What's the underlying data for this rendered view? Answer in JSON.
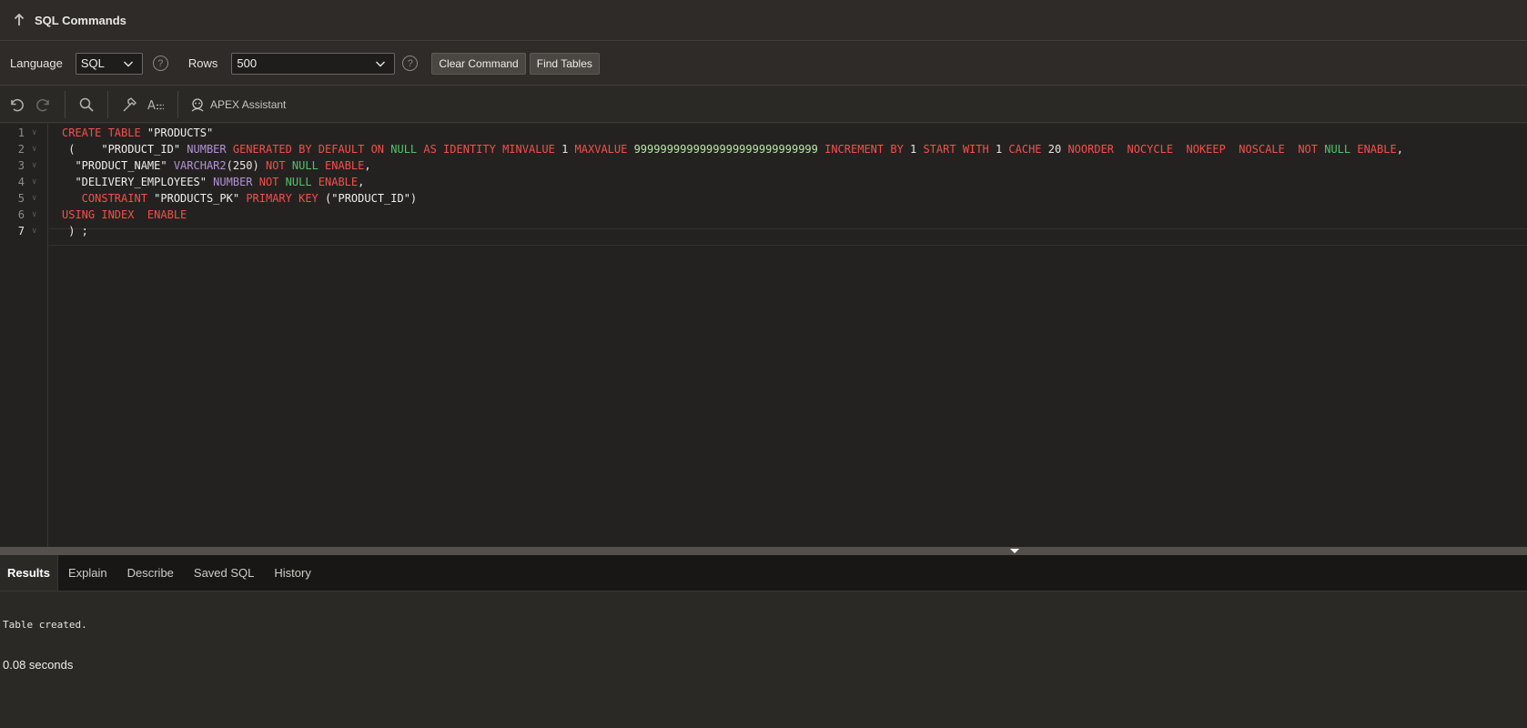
{
  "header": {
    "title": "SQL Commands"
  },
  "options": {
    "language_label": "Language",
    "language_value": "SQL",
    "rows_label": "Rows",
    "rows_value": "500",
    "help_glyph": "?",
    "clear_label": "Clear Command",
    "find_label": "Find Tables"
  },
  "toolbar": {
    "assistant_label": "APEX Assistant",
    "icons": [
      "undo-icon",
      "redo-icon",
      "search-icon",
      "hammer-icon",
      "format-icon",
      "assistant-icon"
    ]
  },
  "editor": {
    "line_numbers": [
      "1",
      "2",
      "3",
      "4",
      "5",
      "6",
      "7"
    ],
    "active_line": 7,
    "lines": [
      [
        {
          "t": "CREATE TABLE ",
          "c": "kw"
        },
        {
          "t": "\"PRODUCTS\"",
          "c": "st"
        }
      ],
      [
        {
          "t": " (    ",
          "c": "nu"
        },
        {
          "t": "\"PRODUCT_ID\" ",
          "c": "st"
        },
        {
          "t": "NUMBER ",
          "c": "ty"
        },
        {
          "t": "GENERATED BY DEFAULT ON ",
          "c": "kw"
        },
        {
          "t": "NULL ",
          "c": "gn"
        },
        {
          "t": "AS IDENTITY MINVALUE ",
          "c": "kw"
        },
        {
          "t": "1 ",
          "c": "nu"
        },
        {
          "t": "MAXVALUE ",
          "c": "kw"
        },
        {
          "t": "9999999999999999999999999999 ",
          "c": "dnum"
        },
        {
          "t": "INCREMENT BY ",
          "c": "kw"
        },
        {
          "t": "1 ",
          "c": "nu"
        },
        {
          "t": "START WITH ",
          "c": "kw"
        },
        {
          "t": "1 ",
          "c": "nu"
        },
        {
          "t": "CACHE ",
          "c": "kw"
        },
        {
          "t": "20 ",
          "c": "nu"
        },
        {
          "t": "NOORDER  NOCYCLE  NOKEEP  NOSCALE  NOT ",
          "c": "kw"
        },
        {
          "t": "NULL ",
          "c": "gn"
        },
        {
          "t": "ENABLE",
          "c": "kw"
        },
        {
          "t": ",",
          "c": "nu"
        }
      ],
      [
        {
          "t": "  \"PRODUCT_NAME\" ",
          "c": "st"
        },
        {
          "t": "VARCHAR2",
          "c": "ty"
        },
        {
          "t": "(250) ",
          "c": "nu"
        },
        {
          "t": "NOT ",
          "c": "kw"
        },
        {
          "t": "NULL ",
          "c": "gn"
        },
        {
          "t": "ENABLE",
          "c": "kw"
        },
        {
          "t": ",",
          "c": "nu"
        }
      ],
      [
        {
          "t": "  \"DELIVERY_EMPLOYEES\" ",
          "c": "st"
        },
        {
          "t": "NUMBER ",
          "c": "ty"
        },
        {
          "t": "NOT ",
          "c": "kw"
        },
        {
          "t": "NULL ",
          "c": "gn"
        },
        {
          "t": "ENABLE",
          "c": "kw"
        },
        {
          "t": ",",
          "c": "nu"
        }
      ],
      [
        {
          "t": "   CONSTRAINT ",
          "c": "kw"
        },
        {
          "t": "\"PRODUCTS_PK\" ",
          "c": "st"
        },
        {
          "t": "PRIMARY KEY ",
          "c": "kw"
        },
        {
          "t": "(\"PRODUCT_ID\")",
          "c": "st"
        }
      ],
      [
        {
          "t": "USING INDEX  ENABLE",
          "c": "kw"
        }
      ],
      [
        {
          "t": " ) ;",
          "c": "nu"
        }
      ]
    ]
  },
  "tabs": [
    {
      "label": "Results",
      "active": true
    },
    {
      "label": "Explain",
      "active": false
    },
    {
      "label": "Describe",
      "active": false
    },
    {
      "label": "Saved SQL",
      "active": false
    },
    {
      "label": "History",
      "active": false
    }
  ],
  "results": {
    "message": "Table created.",
    "timing": "0.08 seconds"
  },
  "colors": {
    "keyword": "#f2504b",
    "type": "#b392d7",
    "null": "#4fc46b",
    "big_number": "#b8e6a8",
    "background": "#2b2926",
    "editor_background": "#242220"
  }
}
